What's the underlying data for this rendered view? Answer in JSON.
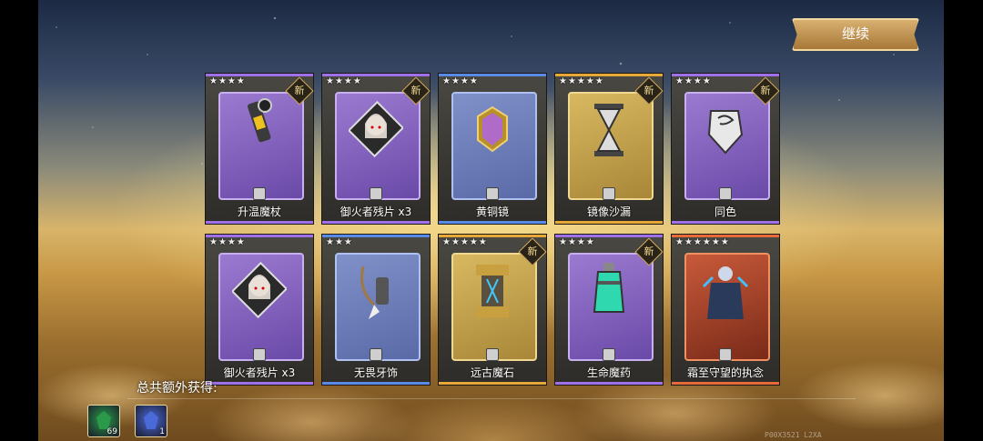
{
  "header": {
    "continue_label": "继续"
  },
  "cards": [
    {
      "name": "升温魔杖",
      "stars": "★★★★",
      "new": "新",
      "rarity": "purple",
      "icon": "staff-icon"
    },
    {
      "name": "御火者残片 x3",
      "stars": "★★★★",
      "new": "新",
      "rarity": "purple",
      "icon": "hero-portrait-icon"
    },
    {
      "name": "黄铜镜",
      "stars": "★★★★",
      "new": "",
      "rarity": "blue",
      "icon": "mirror-icon"
    },
    {
      "name": "镜像沙漏",
      "stars": "★★★★★",
      "new": "新",
      "rarity": "gold",
      "icon": "hourglass-icon"
    },
    {
      "name": "同色",
      "stars": "★★★★",
      "new": "新",
      "rarity": "purple",
      "icon": "gauntlet-icon"
    },
    {
      "name": "御火者残片 x3",
      "stars": "★★★★",
      "new": "",
      "rarity": "purple",
      "icon": "hero-portrait-icon"
    },
    {
      "name": "无畏牙饰",
      "stars": "★★★",
      "new": "",
      "rarity": "blue",
      "icon": "fang-necklace-icon"
    },
    {
      "name": "远古魔石",
      "stars": "★★★★★",
      "new": "新",
      "rarity": "gold",
      "icon": "ancient-stone-icon"
    },
    {
      "name": "生命魔药",
      "stars": "★★★★",
      "new": "新",
      "rarity": "purple",
      "icon": "potion-icon"
    },
    {
      "name": "霜至守望的执念",
      "stars": "★★★★★★",
      "new": "",
      "rarity": "red",
      "icon": "frost-warrior-icon"
    }
  ],
  "footer": {
    "total_label": "总共额外获得:",
    "rewards": [
      {
        "icon": "green-gem-icon",
        "count": "69",
        "color": "#2a9a4a"
      },
      {
        "icon": "blue-crystal-icon",
        "count": "1",
        "color": "#4a6ad8"
      }
    ],
    "watermark": "P00X3521 L2XA"
  }
}
